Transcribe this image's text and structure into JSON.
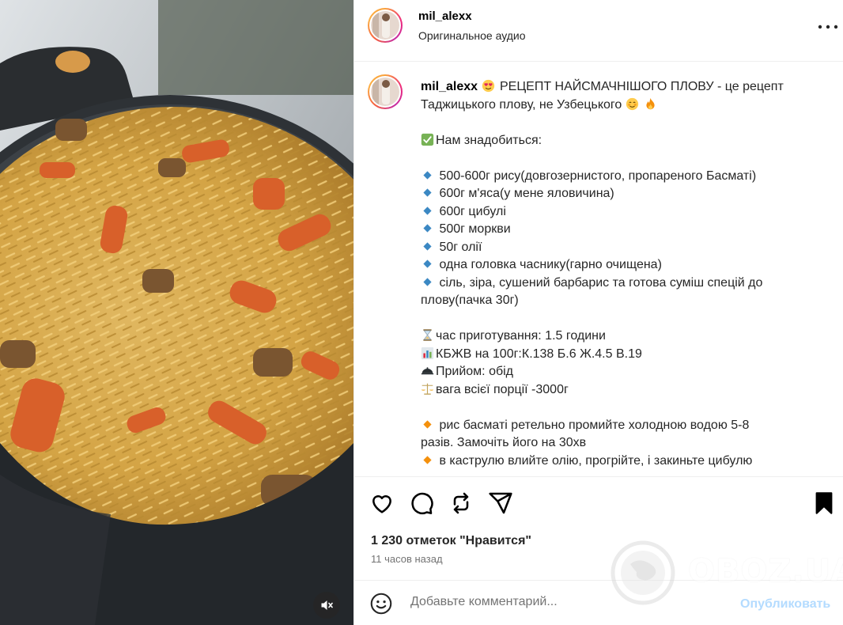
{
  "post": {
    "username": "mil_alexx",
    "audio": "Оригинальное аудио",
    "caption": {
      "line1": "РЕЦЕПТ НАЙСМАЧНІШОГО ПЛОВУ - це рецепт",
      "line2": "Таджицького плову, не Узбецького",
      "need_title": "Нам знадобиться:",
      "ingredients": [
        "500-600г рису(довгозернистого, пропареного Басматі)",
        "600г м'яса(у мене яловичина)",
        "600г цибулі",
        "500г моркви",
        "50г олії",
        "одна головка часнику(гарно очищена)",
        "сіль, зіра, сушений барбарис та готова суміш спецій до"
      ],
      "ingredients_cont": "плову(пачка 30г)",
      "info": {
        "time": "час приготування: 1.5 години",
        "kbju": "КБЖВ на 100г:К.138 Б.6 Ж.4.5 В.19",
        "meal": "Прийом: обід",
        "weight": "вага всієї порції -3000г"
      },
      "steps": {
        "s1a": "рис басматі ретельно промийте холодною водою 5-8",
        "s1b": "разів. Замочіть його на 30хв",
        "s2": "в каструлю влийте олію, прогрійте, і закиньте цибулю"
      }
    },
    "likes": "1 230 отметок \"Нравится\"",
    "time_ago": "11 часов назад"
  },
  "comment": {
    "placeholder": "Добавьте комментарий...",
    "publish": "Опубликовать"
  },
  "watermark": "OBOZ.UA",
  "icons": {
    "more": "more-horizontal-icon",
    "like": "heart-icon",
    "comment": "comment-icon",
    "repost": "repost-icon",
    "share": "share-icon",
    "save": "bookmark-icon",
    "emoji": "smiley-icon",
    "mute": "speaker-muted-icon"
  },
  "colors": {
    "text": "#262626",
    "muted": "#737373",
    "publish": "#b3dbff",
    "border": "#efefef"
  }
}
